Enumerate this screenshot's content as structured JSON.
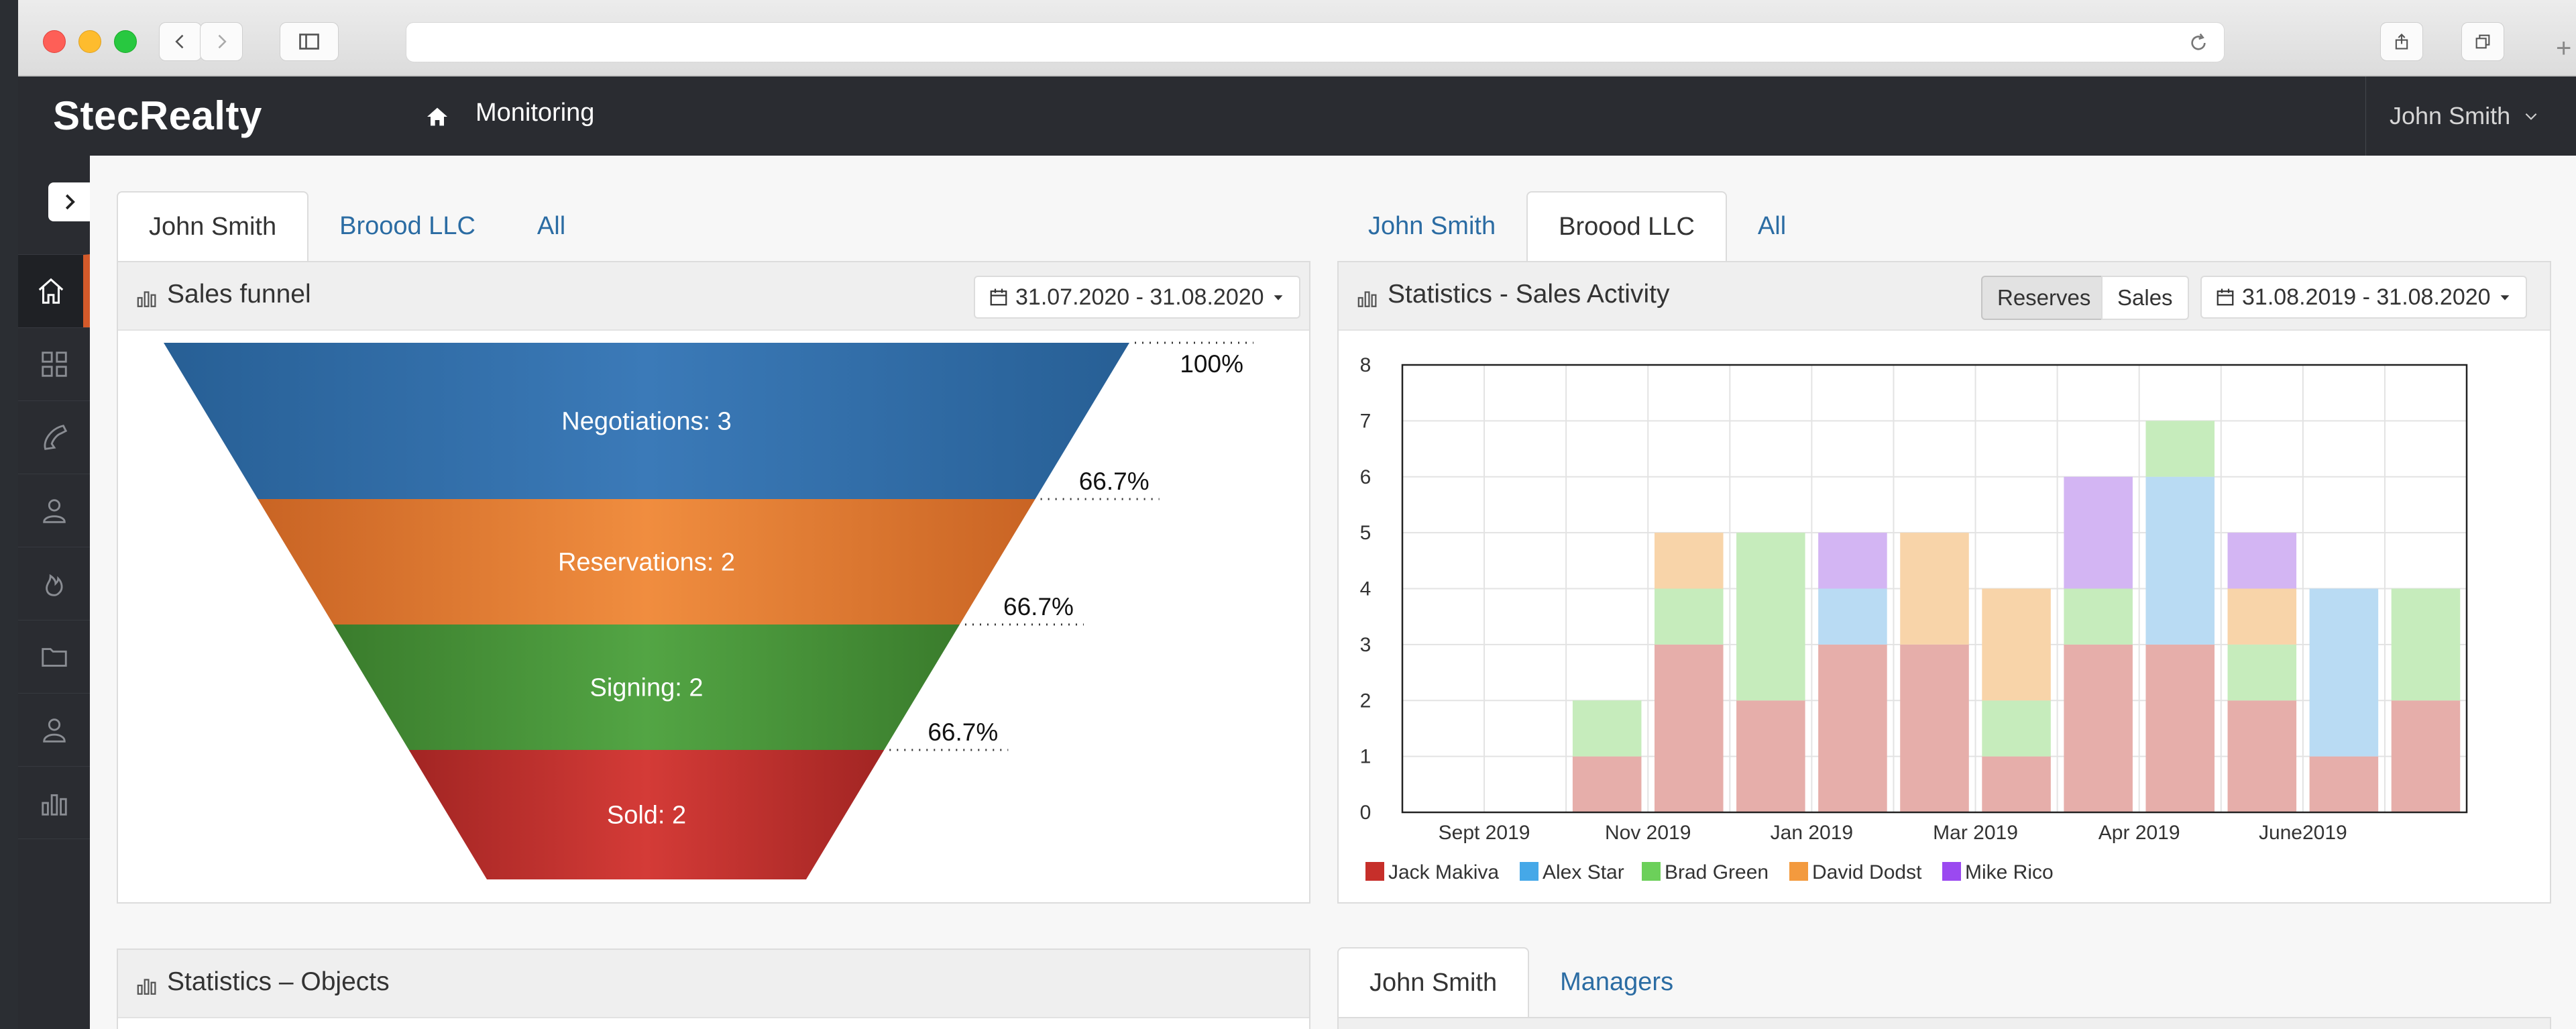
{
  "browser": {
    "address": ""
  },
  "header": {
    "logo": "StecRealty",
    "breadcrumb": "Monitoring",
    "user": "John Smith"
  },
  "sidebar": {
    "items": [
      "home-icon",
      "grid-icon",
      "phone-icon",
      "users-icon",
      "fire-icon",
      "folder-icon",
      "user-icon",
      "chart-icon"
    ]
  },
  "left_tabs": [
    {
      "label": "John Smith",
      "active": true
    },
    {
      "label": "Broood LLC",
      "active": false
    },
    {
      "label": "All",
      "active": false
    }
  ],
  "right_tabs": [
    {
      "label": "John Smith",
      "active": false
    },
    {
      "label": "Broood LLC",
      "active": true
    },
    {
      "label": "All",
      "active": false
    }
  ],
  "funnel_panel": {
    "title": "Sales funnel",
    "date_range": "31.07.2020 - 31.08.2020",
    "stages": [
      {
        "label": "Negotiations: 3",
        "pct": "100%",
        "color": "#3570a8"
      },
      {
        "label": "Reservations: 2",
        "pct": "66.7%",
        "color": "#e9843a"
      },
      {
        "label": "Signing: 2",
        "pct": "66.7%",
        "color": "#4c9a3c"
      },
      {
        "label": "Sold: 2",
        "pct": "66.7%",
        "color": "#c93431"
      }
    ]
  },
  "stats_panel": {
    "title": "Statistics - Sales Activity",
    "buttons": {
      "reserves": "Reserves",
      "sales": "Sales"
    },
    "date_range": "31.08.2019 - 31.08.2020"
  },
  "bottom_left": {
    "title": "Statistics – Objects"
  },
  "bottom_tabs": [
    {
      "label": "John Smith",
      "active": true
    },
    {
      "label": "Managers",
      "active": false
    }
  ],
  "chart_data": {
    "type": "bar",
    "stacked": true,
    "x_tick_labels": [
      "Sept 2019",
      "Nov 2019",
      "Jan 2019",
      "Mar 2019",
      "Apr 2019",
      "June2019"
    ],
    "ylim": [
      0,
      8
    ],
    "yticks": [
      0,
      1,
      2,
      3,
      4,
      5,
      6,
      7,
      8
    ],
    "grid": true,
    "legend_position": "bottom",
    "series": [
      {
        "name": "Jack Makiva",
        "color": "#c62f2a",
        "fill": "#e6aeaa",
        "values": [
          0,
          0,
          1,
          3,
          2,
          3,
          3,
          1,
          3,
          3,
          2,
          1,
          2
        ]
      },
      {
        "name": "Alex Star",
        "color": "#45a8e8",
        "fill": "#b9dbf3",
        "values": [
          0,
          0,
          0,
          0,
          0,
          1,
          0,
          0,
          0,
          3,
          0,
          3,
          0
        ]
      },
      {
        "name": "Brad Green",
        "color": "#6cd05a",
        "fill": "#c6ecbc",
        "values": [
          0,
          0,
          1,
          1,
          3,
          0,
          0,
          1,
          1,
          1,
          1,
          0,
          2
        ]
      },
      {
        "name": "David Dodst",
        "color": "#f39a3e",
        "fill": "#f8d4a9",
        "values": [
          0,
          0,
          0,
          1,
          0,
          0,
          2,
          2,
          0,
          0,
          1,
          0,
          0
        ]
      },
      {
        "name": "Mike Rico",
        "color": "#9b49f0",
        "fill": "#d3b5f3",
        "values": [
          0,
          0,
          0,
          0,
          0,
          1,
          0,
          0,
          2,
          0,
          1,
          0,
          0
        ]
      }
    ]
  }
}
